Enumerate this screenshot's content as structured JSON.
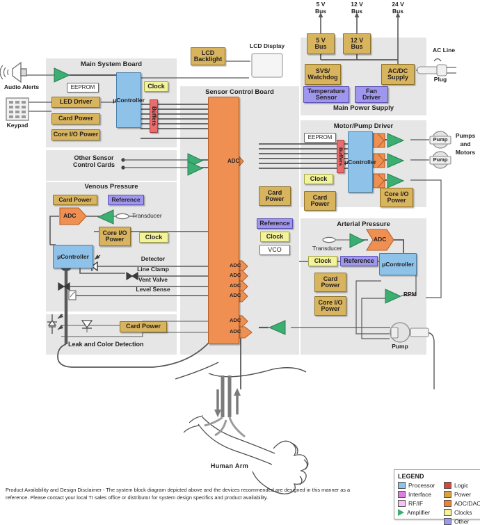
{
  "boards": {
    "main_system_board": {
      "title": "Main System Board",
      "ucontroller": "μController",
      "eeprom": "EEPROM",
      "clock": "Clock",
      "led_driver": "LED Driver",
      "card_power": "Card Power",
      "core_io_power": "Core I/O Power",
      "buffers": "Buffers"
    },
    "sensor_control_board": {
      "title": "Sensor Control Board",
      "adc": "ADC",
      "card_power": "Card Power",
      "reference": "Reference",
      "clock": "Clock",
      "vco": "VCO"
    },
    "main_power_supply": {
      "title": "Main Power Supply",
      "bus5": "5 V\nBus",
      "bus12": "12 V\nBus",
      "svs_watchdog": "SVS/\nWatchdog",
      "acdc_supply": "AC/DC\nSupply",
      "temperature_sensor": "Temperature\nSensor",
      "fan_driver": "Fan\nDriver",
      "rail_5v": "5 V\nBus",
      "rail_12v": "12 V\nBus",
      "rail_24v": "24 V\nBus",
      "ac_line": "AC Line",
      "plug": "Plug"
    },
    "motor_pump_driver": {
      "title": "Motor/Pump Driver",
      "eeprom": "EEPROM",
      "buffers": "Buffers",
      "ucontroller": "μController",
      "clock": "Clock",
      "card_power": "Card Power",
      "core_io_power": "Core I/O Power",
      "pump": "Pump",
      "pumps_and_motors": "Pumps\nand\nMotors"
    },
    "venous_pressure": {
      "title": "Venous Pressure",
      "card_power": "Card Power",
      "reference": "Reference",
      "adc": "ADC",
      "transducer": "Transducer",
      "core_io_power": "Core I/O\nPower",
      "clock": "Clock",
      "ucontroller": "μController",
      "signals": [
        "Detector",
        "Line Clamp",
        "Vent Valve",
        "Level Sense"
      ]
    },
    "arterial_pressure": {
      "title": "Arterial Pressure",
      "transducer": "Transducer",
      "adc": "ADC",
      "clock": "Clock",
      "reference": "Reference",
      "ucontroller": "μController",
      "card_power": "Card Power",
      "core_io_power": "Core I/O\nPower",
      "rpm": "RPM",
      "pump": "Pump"
    },
    "leak_and_color": {
      "title": "Leak and Color Detection",
      "card_power": "Card Power"
    },
    "other_sensor_cards": {
      "title": "Other Sensor\nControl Cards"
    }
  },
  "peripherals": {
    "audio_alerts": "Audio Alerts",
    "keypad": "Keypad",
    "lcd_backlight": "LCD\nBacklight",
    "lcd_display": "LCD Display",
    "human_arm": "Human Arm"
  },
  "legend": {
    "title": "LEGEND",
    "entries": [
      {
        "label": "Processor",
        "color": "#8ec2e8"
      },
      {
        "label": "Logic",
        "color": "#d04a3c"
      },
      {
        "label": "Interface",
        "color": "#df7ddf"
      },
      {
        "label": "Power",
        "color": "#d9a33c"
      },
      {
        "label": "RF/IF",
        "color": "#f6c2f6"
      },
      {
        "label": "ADC/DAC",
        "color": "#ef8330"
      },
      {
        "label": "Amplifier",
        "color": "#3bae72"
      },
      {
        "label": "Clocks",
        "color": "#f3f39a"
      },
      {
        "label": "Other",
        "color": "#9f97ee"
      }
    ]
  },
  "disclaimer": "Product Availability and Design Disclaimer - The system block diagram depicted above and the devices recommended are designed in this manner as a reference.  Please contact your local TI sales office or distributor for system design specifics and product availability."
}
